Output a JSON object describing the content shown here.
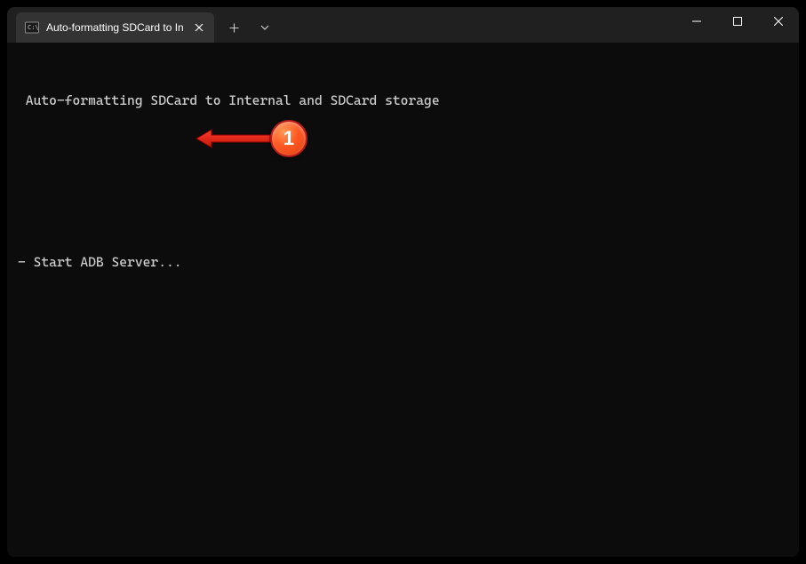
{
  "tab": {
    "title": "Auto-formatting SDCard to In"
  },
  "terminal": {
    "line1": " Auto-formatting SDCard to Internal and SDCard storage",
    "line2": "- Start ADB Server..."
  },
  "annotation": {
    "badge": "1"
  }
}
